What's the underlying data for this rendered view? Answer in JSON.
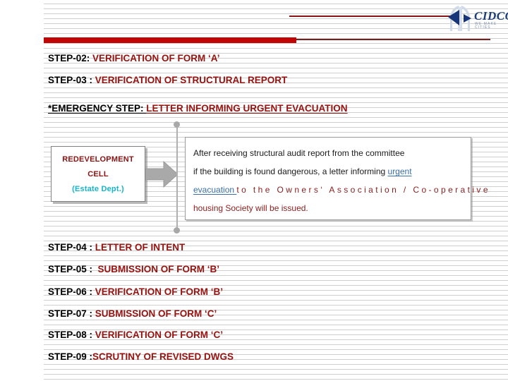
{
  "brand": {
    "logo_name": "cidco-logo",
    "wordmark": "CIDCO",
    "tagline": "WE MAKE CITIES",
    "wordmark_color": "#1d3f78",
    "accent_red": "#c10404",
    "rule_red": "#8c1616"
  },
  "steps_top": [
    {
      "key": "STEP-02:",
      "value": "VERIFICATION OF FORM ‘A’",
      "underlined": false
    },
    {
      "key": "STEP-03 :",
      "value": "VERIFICATION OF STRUCTURAL REPORT",
      "underlined": false
    },
    {
      "key": "*EMERGENCY STEP:",
      "value": "LETTER INFORMING URGENT EVACUATION",
      "underlined": true
    }
  ],
  "diagram": {
    "cell_box": {
      "line1": "REDEVELOPMENT",
      "line2": "CELL",
      "line3": "(Estate Dept.)",
      "line1_color": "#8c1212",
      "line3_color": "#13b5c9"
    },
    "arrow_name": "right-block-arrow",
    "description": {
      "line1_black": "After receiving structural audit report from the committee",
      "line2_black": "if the building is found dangerous, a letter informing ",
      "line2_link": "urgent",
      "line3_link": "evacuation",
      "line3_red": "to   the   Owners‘   Association   /   Co-operative",
      "line4_red": "housing Society will be issued.",
      "link_color": "#3a6ea5",
      "red_color": "#8c2020"
    }
  },
  "steps_bottom": [
    {
      "key": "STEP-04 :",
      "value": "LETTER OF INTENT"
    },
    {
      "key": "STEP-05 :",
      "value": " SUBMISSION OF FORM ‘B’"
    },
    {
      "key": "STEP-06 :",
      "value": "VERIFICATION OF FORM ‘B’"
    },
    {
      "key": "STEP-07 :",
      "value": "SUBMISSION OF FORM ‘C’"
    },
    {
      "key": "STEP-08 :",
      "value": "VERIFICATION OF FORM ‘C’"
    },
    {
      "key": "STEP-09 :",
      "value": "SCRUTINY OF REVISED DWGS"
    }
  ]
}
